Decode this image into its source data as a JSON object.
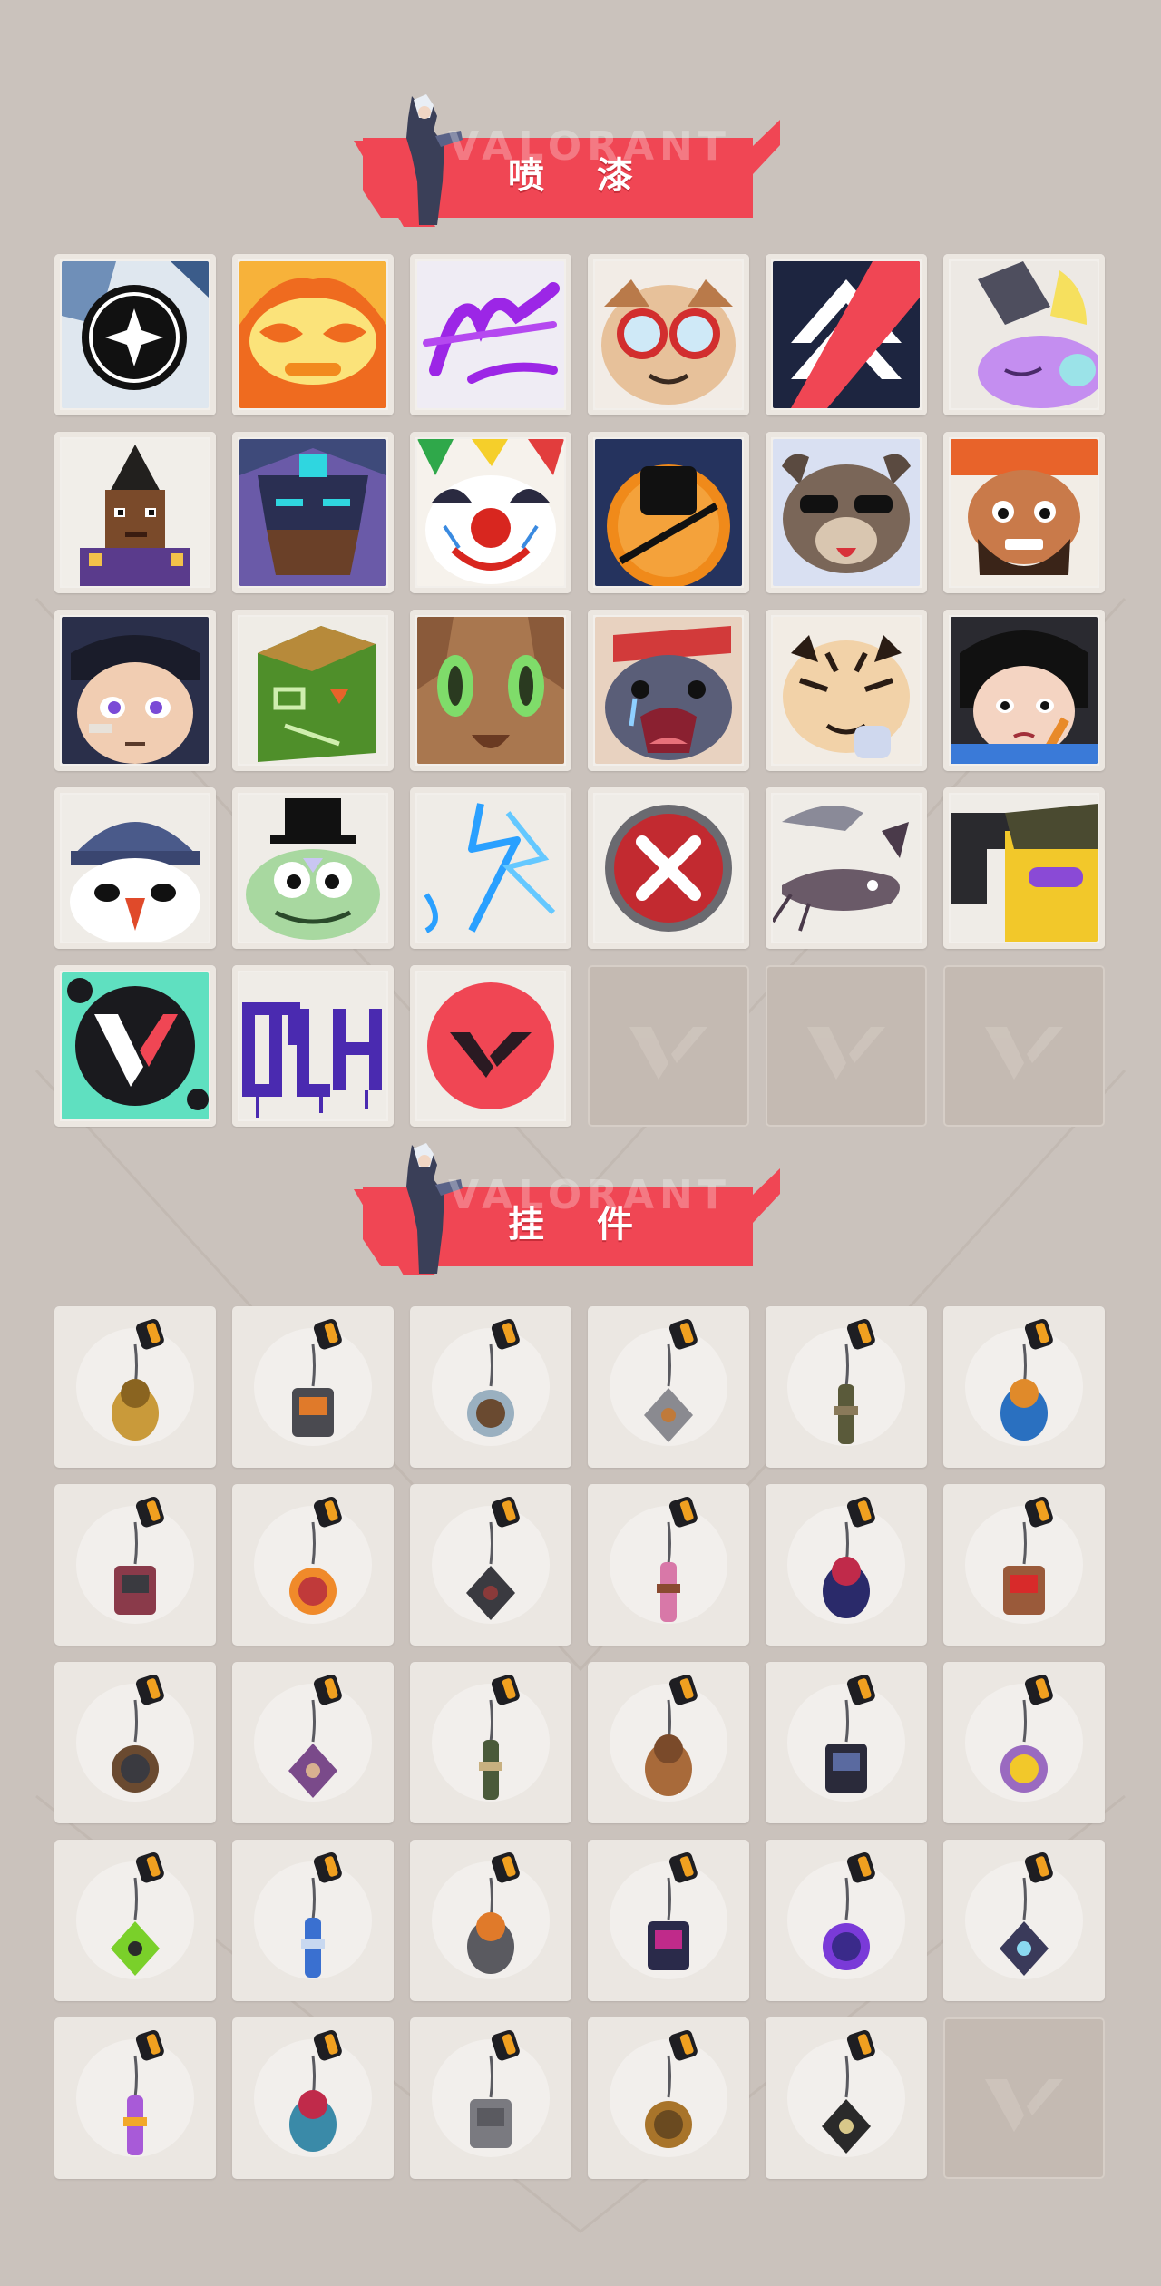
{
  "sections": [
    {
      "title": "喷 漆",
      "brand_watermark": "VALORANT"
    },
    {
      "title": "挂 件",
      "brand_watermark": "VALORANT"
    }
  ],
  "sprays": [
    "star-ring-spray-icon",
    "fire-mask-spray-icon",
    "purple-graffiti-spray-icon",
    "goggles-creature-spray-icon",
    "chevron-emblem-spray-icon",
    "purple-blob-spray-icon",
    "pixel-agent-spray-icon",
    "armored-robot-spray-icon",
    "clown-spray-icon",
    "orange-dial-spray-icon",
    "sunglasses-bear-spray-icon",
    "bearded-agent-spray-icon",
    "bandaged-agent-spray-icon",
    "green-crate-spray-icon",
    "green-eyes-creature-spray-icon",
    "crying-creature-spray-icon",
    "tiger-spray-icon",
    "determined-agent-spray-icon",
    "beanie-penguin-spray-icon",
    "top-hat-frog-spray-icon",
    "neon-bolt-spray-icon",
    "red-x-button-spray-icon",
    "catfish-spray-icon",
    "pistol-creature-spray-icon",
    "valorant-splatter-spray-icon",
    "purple-tag-spray-icon",
    "red-v-circle-spray-icon",
    "empty-slot-icon",
    "empty-slot-icon",
    "empty-slot-icon"
  ],
  "charms": [
    "gold-cat-charm-icon",
    "drone-charm-icon",
    "hot-tub-charm-icon",
    "raccoon-charm-icon",
    "grenade-pouch-charm-icon",
    "blue-canister-charm-icon",
    "serrated-blade-charm-icon",
    "candy-corn-charm-icon",
    "rope-knot-charm-icon",
    "cupcake-charm-icon",
    "ep9-badge-charm-icon",
    "teddy-bear-charm-icon",
    "tool-belt-charm-icon",
    "agent-figure-charm-icon",
    "cowboy-robot-charm-icon",
    "treasure-chest-charm-icon",
    "tassel-robot-charm-icon",
    "lava-lamp-charm-icon",
    "pager-charm-icon",
    "astronaut-charm-icon",
    "radio-charm-icon",
    "ep9-round-charm-icon",
    "pixel-heart-charm-icon",
    "crystal-lantern-charm-icon",
    "lotus-flame-charm-icon",
    "ufo-charm-icon",
    "grey-cat-charm-icon",
    "wax-seal-charm-icon",
    "valorant-tag-charm-icon",
    "empty-slot-icon"
  ],
  "colors": {
    "background": "#cac2bc",
    "banner": "#f04654",
    "tile": "#f2efeb",
    "empty_tile": "#c4bab2"
  }
}
